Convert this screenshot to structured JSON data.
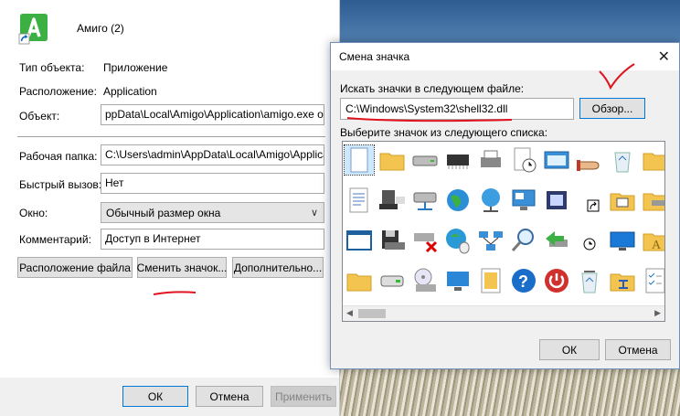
{
  "properties": {
    "app_name": "Амиго (2)",
    "rows": [
      {
        "label": "Тип объекта:",
        "value": "Приложение"
      },
      {
        "label": "Расположение:",
        "value": "Application"
      }
    ],
    "object": {
      "label": "Объект:",
      "value": "ppData\\Local\\Amigo\\Application\\amigo.exe ok.ru"
    },
    "working_dir": {
      "label": "Рабочая папка:",
      "value": "C:\\Users\\admin\\AppData\\Local\\Amigo\\Applicatio"
    },
    "shortcut": {
      "label": "Быстрый вызов:",
      "value": "Нет"
    },
    "window": {
      "label": "Окно:",
      "value": "Обычный размер окна"
    },
    "comment": {
      "label": "Комментарий:",
      "value": "Доступ в Интернет"
    },
    "buttons": {
      "file_location": "Расположение файла",
      "change_icon": "Сменить значок...",
      "advanced": "Дополнительно..."
    },
    "footer": {
      "ok": "ОК",
      "cancel": "Отмена",
      "apply": "Применить"
    }
  },
  "dialog": {
    "title": "Смена значка",
    "search_label": "Искать значки в следующем файле:",
    "path_value": "C:\\Windows\\System32\\shell32.dll",
    "browse": "Обзор...",
    "list_label": "Выберите значок из следующего списка:",
    "ok": "ОК",
    "cancel": "Отмена",
    "close_glyph": "✕"
  },
  "colors": {
    "annotation_red": "#e0141e",
    "focus_blue": "#0078d7",
    "amigo_green": "#3cb043"
  },
  "icons": [
    "blank-document-icon",
    "folder-icon",
    "drive-icon",
    "memory-chip-icon",
    "printer-icon",
    "clock-document-icon",
    "window-shortcut-icon",
    "hand-icon",
    "recycle-bin-icon",
    "folder-icon",
    "text-document-icon",
    "computer-icon",
    "network-drive-icon",
    "globe-icon",
    "network-globe-icon",
    "display-settings-icon",
    "run-icon",
    "shortcut-arrow-icon",
    "shared-folder-icon",
    "drive-folder-icon",
    "window-icon",
    "floppy-icon",
    "network-disconnected-icon",
    "globe-mouse-icon",
    "network-icon",
    "search-icon",
    "run-arrow-icon",
    "clock-icon",
    "monitor-icon",
    "font-folder-icon",
    "folder-icon",
    "removable-drive-icon",
    "cd-drive-icon",
    "desktop-icon",
    "grid-document-icon",
    "help-icon",
    "power-icon",
    "recycle-bin-full-icon",
    "network-folder-icon",
    "checklist-icon"
  ]
}
